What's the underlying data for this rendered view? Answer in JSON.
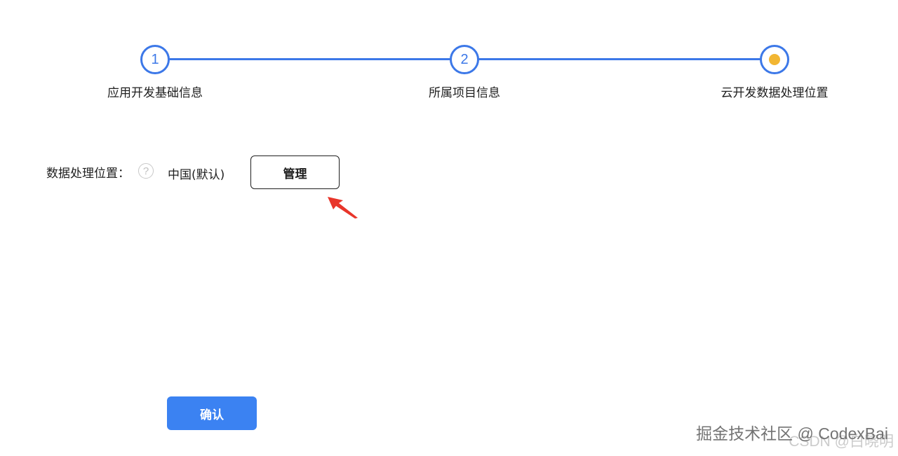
{
  "stepper": {
    "steps": [
      {
        "number": "1",
        "label": "应用开发基础信息",
        "state": "completed"
      },
      {
        "number": "2",
        "label": "所属项目信息",
        "state": "completed"
      },
      {
        "number": "",
        "label": "云开发数据处理位置",
        "state": "current"
      }
    ],
    "colors": {
      "line": "#3c78e8",
      "current_dot": "#f2b632"
    }
  },
  "form": {
    "field_label": "数据处理位置：",
    "help_icon": "question-circle-icon",
    "help_glyph": "?",
    "field_value": "中国(默认)",
    "manage_label": "管理"
  },
  "annotation": {
    "arrow_color": "#e8352a"
  },
  "actions": {
    "confirm_label": "确认",
    "confirm_color": "#3b82f2"
  },
  "watermark": {
    "text": "掘金技术社区 @ CodexBai",
    "text2": "CSDN @白晓明"
  }
}
